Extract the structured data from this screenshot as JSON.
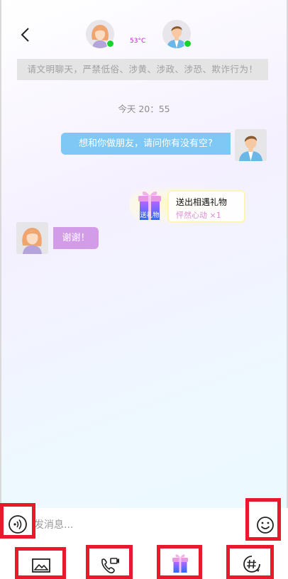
{
  "header": {
    "temperature": "53°C"
  },
  "notice": "请文明聊天，严禁低俗、涉黄、涉政、涉恐、欺诈行为！",
  "chat": {
    "timestamp": "今天 20：55",
    "messages": [
      {
        "side": "right",
        "text": "想和你做朋友，请问你有没有空?"
      },
      {
        "side": "left",
        "text": "谢谢！"
      }
    ],
    "gift": {
      "icon_label": "送礼物",
      "title": "送出相遇礼物",
      "subtitle": "怦然心动 ×1"
    }
  },
  "input": {
    "placeholder": "发消息..."
  },
  "icons": {
    "voice": "voice-icon",
    "emoji": "emoji-icon",
    "image": "image-icon",
    "call": "video-call-icon",
    "gift": "gift-icon",
    "topic": "hashtag-icon"
  },
  "colors": {
    "sent_bubble": "#7fc7f4",
    "received_bubble": "#d29ce8",
    "online": "#1bd12b",
    "highlight_box": "#e8192c"
  }
}
